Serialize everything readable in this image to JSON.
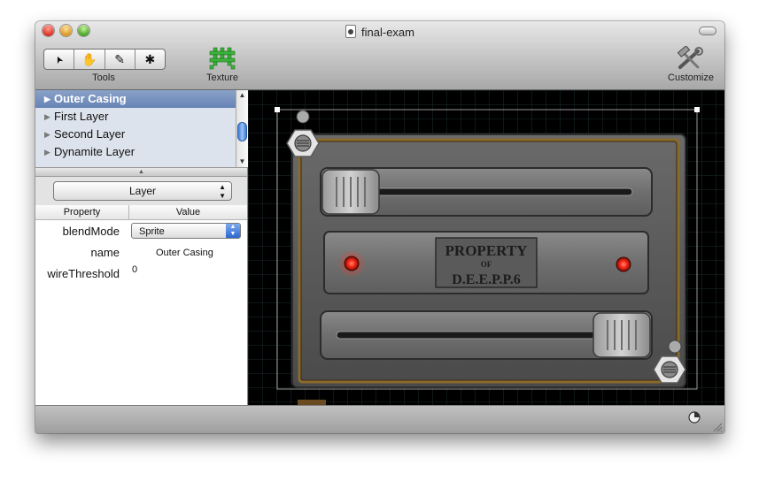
{
  "window": {
    "title": "final-exam"
  },
  "toolbar": {
    "tools_label": "Tools",
    "texture_label": "Texture",
    "customize_label": "Customize",
    "tool_buttons": [
      {
        "name": "arrow-tool",
        "glyph": "➤"
      },
      {
        "name": "hand-tool",
        "glyph": "✋"
      },
      {
        "name": "pencil-tool",
        "glyph": "✎"
      },
      {
        "name": "gear-tool",
        "glyph": "✱"
      }
    ]
  },
  "layers": {
    "items": [
      {
        "label": "Outer Casing",
        "selected": true
      },
      {
        "label": "First Layer",
        "selected": false
      },
      {
        "label": "Second Layer",
        "selected": false
      },
      {
        "label": "Dynamite Layer",
        "selected": false
      }
    ]
  },
  "inspector": {
    "popup_value": "Layer",
    "columns": {
      "property": "Property",
      "value": "Value"
    },
    "rows": [
      {
        "key": "blendMode",
        "value": "Sprite",
        "control": "select"
      },
      {
        "key": "name",
        "value": "Outer Casing",
        "control": "text"
      },
      {
        "key": "wireThreshold",
        "value": "0",
        "control": "number"
      }
    ]
  },
  "canvas": {
    "label_line1": "PROPERTY",
    "label_line2": "OF",
    "label_line3": "D.E.E.P.P.6",
    "colors": {
      "background": "#000000",
      "grid": "#1e2b2e",
      "plate": "#585858",
      "brass": "#8a6a2c",
      "light_red": "#ff2b1a"
    }
  }
}
